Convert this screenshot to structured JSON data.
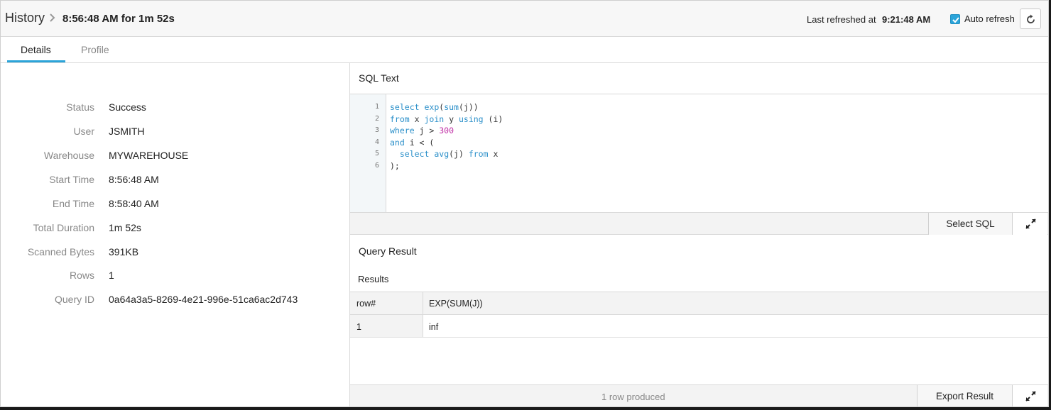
{
  "header": {
    "breadcrumb_root": "History",
    "breadcrumb_current": "8:56:48 AM for 1m 52s",
    "last_refreshed_label": "Last refreshed at",
    "last_refreshed_time": "9:21:48 AM",
    "auto_refresh_label": "Auto refresh",
    "auto_refresh_checked": true
  },
  "tabs": [
    {
      "label": "Details",
      "active": true
    },
    {
      "label": "Profile",
      "active": false
    }
  ],
  "details": [
    {
      "label": "Status",
      "value": "Success"
    },
    {
      "label": "User",
      "value": "JSMITH"
    },
    {
      "label": "Warehouse",
      "value": "MYWAREHOUSE"
    },
    {
      "label": "Start Time",
      "value": "8:56:48 AM"
    },
    {
      "label": "End Time",
      "value": "8:58:40 AM"
    },
    {
      "label": "Total Duration",
      "value": "1m 52s"
    },
    {
      "label": "Scanned Bytes",
      "value": "391KB"
    },
    {
      "label": "Rows",
      "value": "1"
    },
    {
      "label": "Query ID",
      "value": "0a64a3a5-8269-4e21-996e-51ca6ac2d743"
    }
  ],
  "sql": {
    "title": "SQL Text",
    "line_numbers": [
      "1",
      "2",
      "3",
      "4",
      "5",
      "6"
    ],
    "select_button": "Select SQL"
  },
  "result": {
    "title": "Query Result",
    "subtitle": "Results",
    "columns": [
      "row#",
      "EXP(SUM(J))"
    ],
    "rows": [
      [
        "1",
        "inf"
      ]
    ],
    "footer_status": "1 row produced",
    "export_button": "Export Result"
  },
  "colors": {
    "accent": "#2ba4d9",
    "keyword": "#2a8fc9",
    "number": "#c02fa5"
  }
}
